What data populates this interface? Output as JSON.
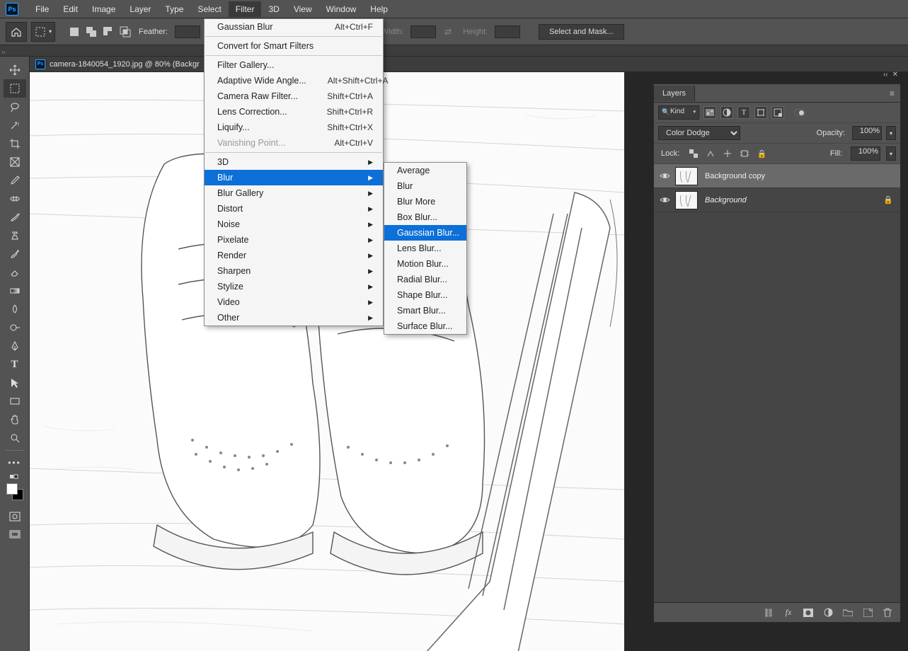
{
  "menubar": {
    "items": [
      "File",
      "Edit",
      "Image",
      "Layer",
      "Type",
      "Select",
      "Filter",
      "3D",
      "View",
      "Window",
      "Help"
    ],
    "open_index": 6
  },
  "optionsbar": {
    "feather_label": "Feather:",
    "width_label": "Width:",
    "height_label": "Height:",
    "select_mask": "Select and Mask..."
  },
  "doctab": {
    "title": "camera-1840054_1920.jpg @ 80% (Backgr"
  },
  "filter_menu": {
    "items": [
      {
        "label": "Gaussian Blur",
        "shortcut": "Alt+Ctrl+F",
        "arrow": false
      },
      {
        "sep": true
      },
      {
        "label": "Convert for Smart Filters",
        "arrow": false
      },
      {
        "sep": true
      },
      {
        "label": "Filter Gallery...",
        "arrow": false
      },
      {
        "label": "Adaptive Wide Angle...",
        "shortcut": "Alt+Shift+Ctrl+A",
        "arrow": false
      },
      {
        "label": "Camera Raw Filter...",
        "shortcut": "Shift+Ctrl+A",
        "arrow": false
      },
      {
        "label": "Lens Correction...",
        "shortcut": "Shift+Ctrl+R",
        "arrow": false
      },
      {
        "label": "Liquify...",
        "shortcut": "Shift+Ctrl+X",
        "arrow": false
      },
      {
        "label": "Vanishing Point...",
        "shortcut": "Alt+Ctrl+V",
        "arrow": false,
        "disabled": true
      },
      {
        "sep": true
      },
      {
        "label": "3D",
        "arrow": true
      },
      {
        "label": "Blur",
        "arrow": true,
        "highlighted": true
      },
      {
        "label": "Blur Gallery",
        "arrow": true
      },
      {
        "label": "Distort",
        "arrow": true
      },
      {
        "label": "Noise",
        "arrow": true
      },
      {
        "label": "Pixelate",
        "arrow": true
      },
      {
        "label": "Render",
        "arrow": true
      },
      {
        "label": "Sharpen",
        "arrow": true
      },
      {
        "label": "Stylize",
        "arrow": true
      },
      {
        "label": "Video",
        "arrow": true
      },
      {
        "label": "Other",
        "arrow": true
      }
    ]
  },
  "blur_submenu": {
    "items": [
      {
        "label": "Average"
      },
      {
        "label": "Blur"
      },
      {
        "label": "Blur More"
      },
      {
        "label": "Box Blur..."
      },
      {
        "label": "Gaussian Blur...",
        "highlighted": true
      },
      {
        "label": "Lens Blur..."
      },
      {
        "label": "Motion Blur..."
      },
      {
        "label": "Radial Blur..."
      },
      {
        "label": "Shape Blur..."
      },
      {
        "label": "Smart Blur..."
      },
      {
        "label": "Surface Blur..."
      }
    ]
  },
  "layers_panel": {
    "tab": "Layers",
    "kind": "Kind",
    "blend_mode": "Color Dodge",
    "opacity_label": "Opacity:",
    "opacity_value": "100%",
    "fill_label": "Fill:",
    "fill_value": "100%",
    "lock_label": "Lock:",
    "layers": [
      {
        "name": "Background copy",
        "selected": true,
        "italic": false,
        "locked": false
      },
      {
        "name": "Background",
        "selected": false,
        "italic": true,
        "locked": true
      }
    ]
  }
}
